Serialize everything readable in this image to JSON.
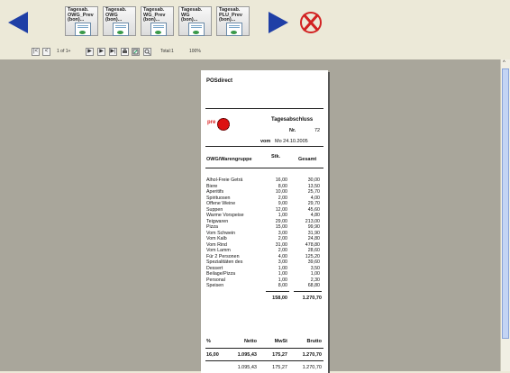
{
  "toolbar": {
    "reports": [
      {
        "label": "Tagesab.\nOWG_Prev\n(bon)..."
      },
      {
        "label": "Tagesab.\nOWG\n(bon)..."
      },
      {
        "label": "Tagesab.\nWG_Prev\n(bon)..."
      },
      {
        "label": "Tagesab.\nWG\n(bon)..."
      },
      {
        "label": "Tagesab.\nPLU_Prev\n(bon)..."
      }
    ],
    "colors": {
      "nav_arrow": "#1f3fa6",
      "close_x": "#d22222"
    }
  },
  "status": {
    "page_info": "1 of 1+",
    "total": "Total:1",
    "zoom": "100%"
  },
  "receipt": {
    "company": "POSdirect",
    "logo_text": "pre",
    "title": "Tagesabschluss",
    "nr_label": "Nr.",
    "nr_value": "72",
    "date_label": "vom",
    "date_value": "Mo 24.10.2005",
    "header": {
      "group": "OWG/Warengruppe",
      "qty": "Stk.",
      "total": "Gesamt"
    },
    "rows": [
      {
        "name": "Alhol-Freie Geträ",
        "qty": "16,00",
        "amt": "30,00"
      },
      {
        "name": "Biere",
        "qty": "8,00",
        "amt": "13,50"
      },
      {
        "name": "Aperitifs",
        "qty": "10,00",
        "amt": "25,70"
      },
      {
        "name": "Spirituosen",
        "qty": "2,00",
        "amt": "4,00"
      },
      {
        "name": "Offene Weine",
        "qty": "9,00",
        "amt": "29,70"
      },
      {
        "name": "Suppen",
        "qty": "12,00",
        "amt": "45,60"
      },
      {
        "name": "Warme Vorspeise",
        "qty": "1,00",
        "amt": "4,80"
      },
      {
        "name": "Teigwaren",
        "qty": "29,00",
        "amt": "213,00"
      },
      {
        "name": "Pizza",
        "qty": "15,00",
        "amt": "99,90"
      },
      {
        "name": "Vom Schwein",
        "qty": "3,00",
        "amt": "31,90"
      },
      {
        "name": "Vom Kalb",
        "qty": "2,00",
        "amt": "24,80"
      },
      {
        "name": "Vom Rind",
        "qty": "31,00",
        "amt": "478,80"
      },
      {
        "name": "Vom Lamm",
        "qty": "2,00",
        "amt": "28,60"
      },
      {
        "name": "Für 2 Personen",
        "qty": "4,00",
        "amt": "125,20"
      },
      {
        "name": "Spezialitäten des",
        "qty": "3,00",
        "amt": "39,60"
      },
      {
        "name": "Dessert",
        "qty": "1,00",
        "amt": "3,50"
      },
      {
        "name": "Beilage/Pizza",
        "qty": "1,00",
        "amt": "1,00"
      },
      {
        "name": "Personal",
        "qty": "1,00",
        "amt": "2,30"
      },
      {
        "name": "Speisen",
        "qty": "8,00",
        "amt": "68,80"
      }
    ],
    "sum_qty": "158,00",
    "sum_amt": "1.270,70",
    "tax_header": {
      "pct": "%",
      "net": "Netto",
      "vat": "MwSt",
      "gross": "Brutto"
    },
    "tax_row": {
      "pct": "16,00",
      "net": "1.095,43",
      "vat": "175,27",
      "gross": "1.270,70"
    },
    "tax_total": {
      "net": "1.095,43",
      "vat": "175,27",
      "gross": "1.270,70"
    }
  }
}
